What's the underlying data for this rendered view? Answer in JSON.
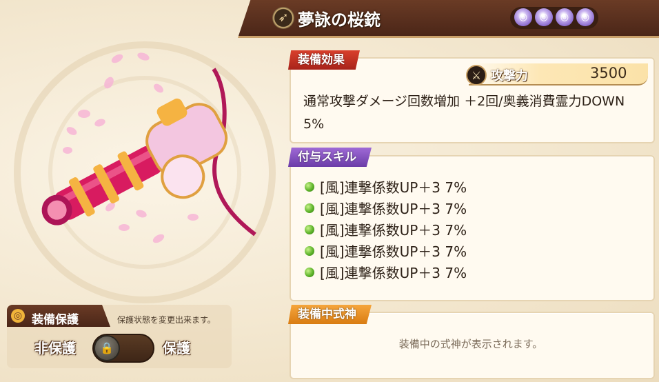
{
  "weapon": {
    "name": "夢詠の桜銃",
    "type_icon": "bow-icon",
    "gem_icon": "spiral-orb-icon",
    "gem_count": 4
  },
  "effect": {
    "tab_label": "装備効果",
    "stat_icon": "crossed-swords-icon",
    "stat_label": "攻撃力",
    "stat_value": "3500",
    "description": "通常攻撃ダメージ回数増加 ＋2回/奥義消費霊力DOWN 5%"
  },
  "skills": {
    "tab_label": "付与スキル",
    "items": [
      "[風]連撃係数UP＋3 7%",
      "[風]連撃係数UP＋3 7%",
      "[風]連撃係数UP＋3 7%",
      "[風]連撃係数UP＋3 7%",
      "[風]連撃係数UP＋3 7%"
    ]
  },
  "shikigami": {
    "tab_label": "装備中式神",
    "placeholder": "装備中の式神が表示されます。"
  },
  "protection": {
    "title": "装備保護",
    "description": "保護状態を変更出来ます。",
    "off_label": "非保護",
    "on_label": "保護",
    "state": "off"
  },
  "colors": {
    "title_bar": "#4b2618",
    "effect_tab": "#c0301f",
    "skill_tab": "#8350c0",
    "shikigami_tab": "#ec9226",
    "weapon_main": "#e0307a"
  }
}
